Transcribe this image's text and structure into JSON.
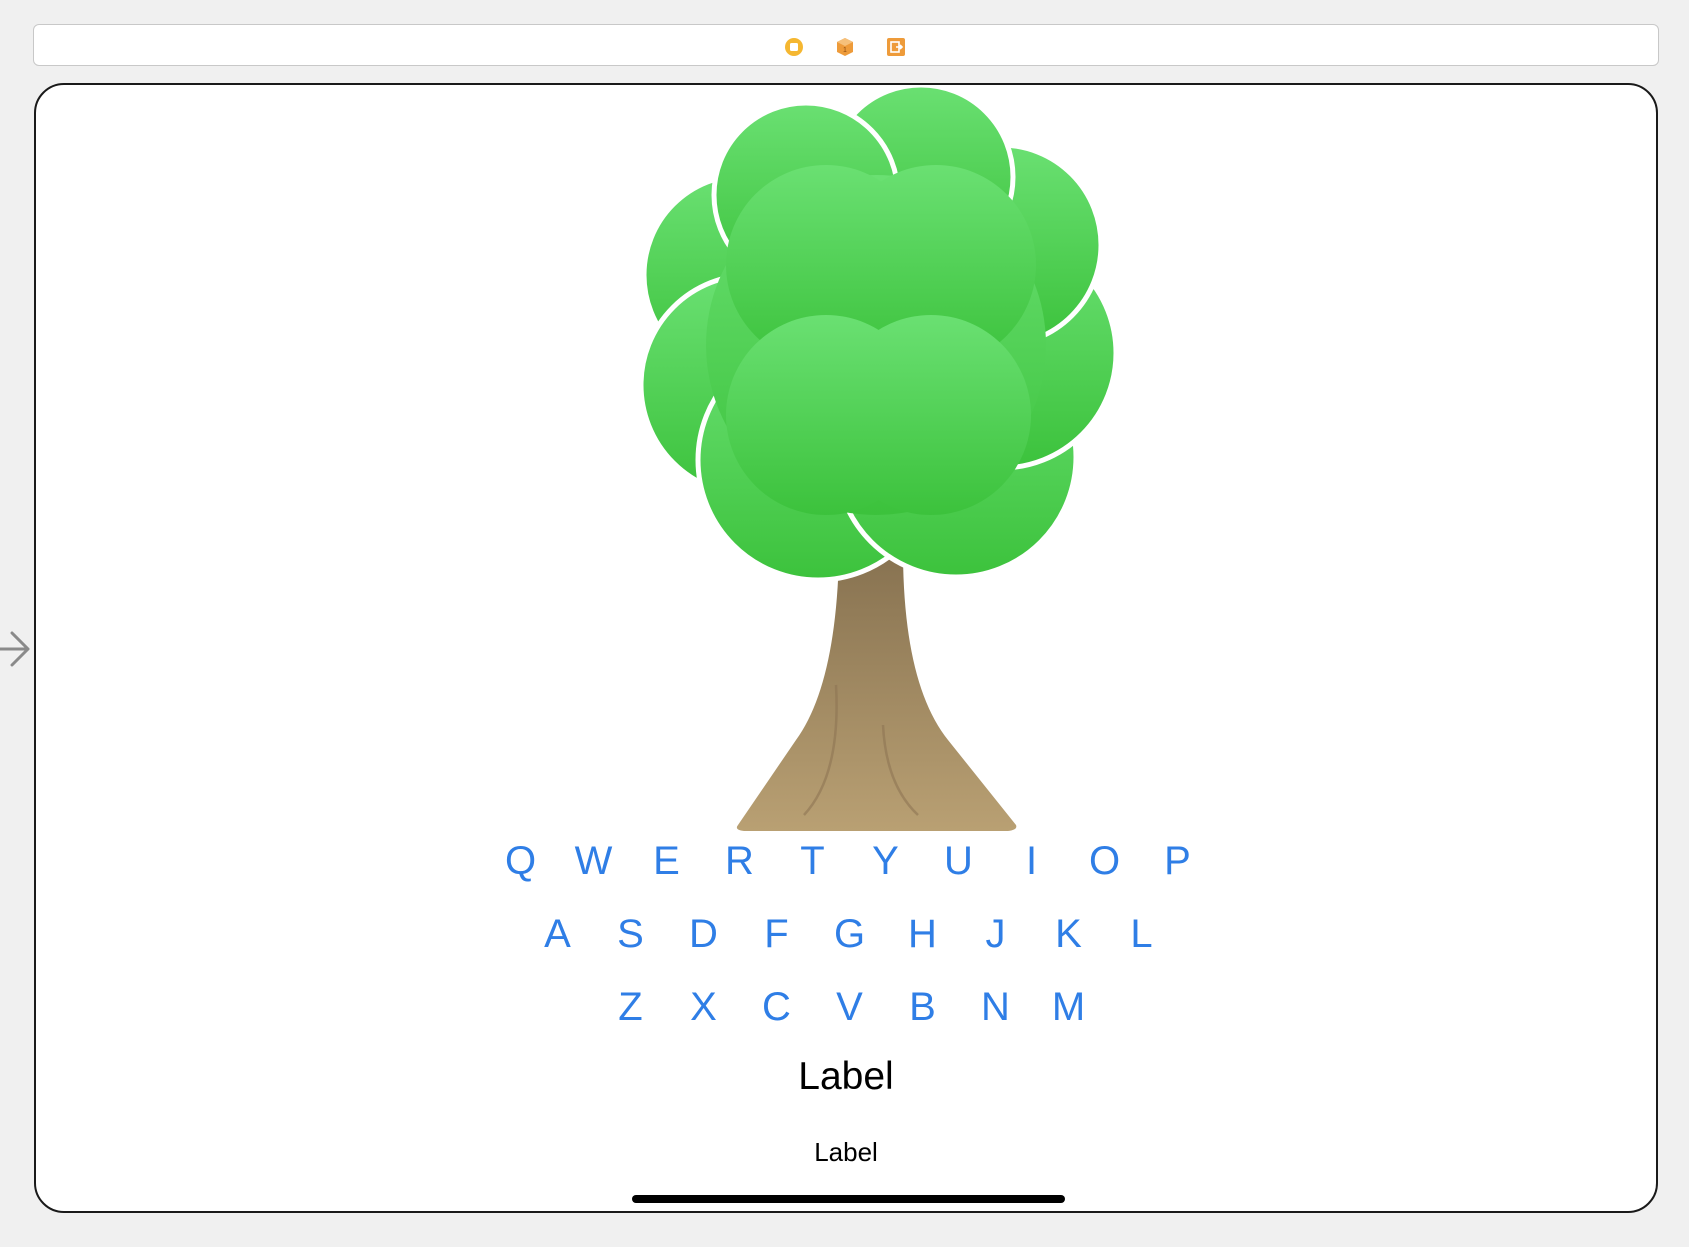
{
  "scene_dock": {
    "icons": [
      {
        "name": "view-controller-icon",
        "color": "#f5b731"
      },
      {
        "name": "first-responder-icon",
        "color": "#ee9b3a"
      },
      {
        "name": "exit-icon",
        "color": "#ee9b3a"
      }
    ]
  },
  "entry_point": {
    "icon": "entry-arrow-icon"
  },
  "tree_image": {
    "icon": "tree-icon",
    "leaf_color": "#4cd24f",
    "trunk_color": "#9c8561"
  },
  "keyboard": {
    "accent": "#2f7ee6",
    "rows": [
      [
        "Q",
        "W",
        "E",
        "R",
        "T",
        "Y",
        "U",
        "I",
        "O",
        "P"
      ],
      [
        "A",
        "S",
        "D",
        "F",
        "G",
        "H",
        "J",
        "K",
        "L"
      ],
      [
        "Z",
        "X",
        "C",
        "V",
        "B",
        "N",
        "M"
      ]
    ]
  },
  "labels": {
    "primary": "Label",
    "secondary": "Label"
  }
}
